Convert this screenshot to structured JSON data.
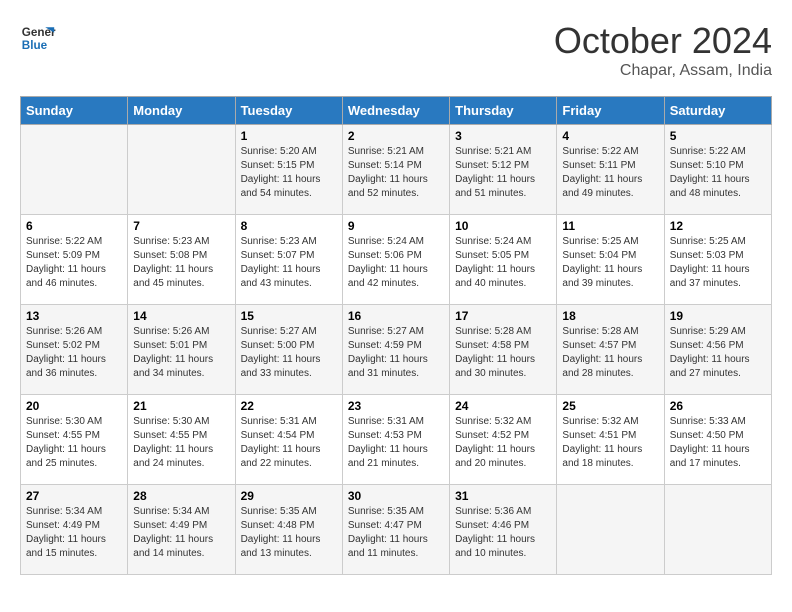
{
  "header": {
    "logo_line1": "General",
    "logo_line2": "Blue",
    "month": "October 2024",
    "location": "Chapar, Assam, India"
  },
  "weekdays": [
    "Sunday",
    "Monday",
    "Tuesday",
    "Wednesday",
    "Thursday",
    "Friday",
    "Saturday"
  ],
  "weeks": [
    [
      {
        "day": "",
        "info": ""
      },
      {
        "day": "",
        "info": ""
      },
      {
        "day": "1",
        "info": "Sunrise: 5:20 AM\nSunset: 5:15 PM\nDaylight: 11 hours and 54 minutes."
      },
      {
        "day": "2",
        "info": "Sunrise: 5:21 AM\nSunset: 5:14 PM\nDaylight: 11 hours and 52 minutes."
      },
      {
        "day": "3",
        "info": "Sunrise: 5:21 AM\nSunset: 5:12 PM\nDaylight: 11 hours and 51 minutes."
      },
      {
        "day": "4",
        "info": "Sunrise: 5:22 AM\nSunset: 5:11 PM\nDaylight: 11 hours and 49 minutes."
      },
      {
        "day": "5",
        "info": "Sunrise: 5:22 AM\nSunset: 5:10 PM\nDaylight: 11 hours and 48 minutes."
      }
    ],
    [
      {
        "day": "6",
        "info": "Sunrise: 5:22 AM\nSunset: 5:09 PM\nDaylight: 11 hours and 46 minutes."
      },
      {
        "day": "7",
        "info": "Sunrise: 5:23 AM\nSunset: 5:08 PM\nDaylight: 11 hours and 45 minutes."
      },
      {
        "day": "8",
        "info": "Sunrise: 5:23 AM\nSunset: 5:07 PM\nDaylight: 11 hours and 43 minutes."
      },
      {
        "day": "9",
        "info": "Sunrise: 5:24 AM\nSunset: 5:06 PM\nDaylight: 11 hours and 42 minutes."
      },
      {
        "day": "10",
        "info": "Sunrise: 5:24 AM\nSunset: 5:05 PM\nDaylight: 11 hours and 40 minutes."
      },
      {
        "day": "11",
        "info": "Sunrise: 5:25 AM\nSunset: 5:04 PM\nDaylight: 11 hours and 39 minutes."
      },
      {
        "day": "12",
        "info": "Sunrise: 5:25 AM\nSunset: 5:03 PM\nDaylight: 11 hours and 37 minutes."
      }
    ],
    [
      {
        "day": "13",
        "info": "Sunrise: 5:26 AM\nSunset: 5:02 PM\nDaylight: 11 hours and 36 minutes."
      },
      {
        "day": "14",
        "info": "Sunrise: 5:26 AM\nSunset: 5:01 PM\nDaylight: 11 hours and 34 minutes."
      },
      {
        "day": "15",
        "info": "Sunrise: 5:27 AM\nSunset: 5:00 PM\nDaylight: 11 hours and 33 minutes."
      },
      {
        "day": "16",
        "info": "Sunrise: 5:27 AM\nSunset: 4:59 PM\nDaylight: 11 hours and 31 minutes."
      },
      {
        "day": "17",
        "info": "Sunrise: 5:28 AM\nSunset: 4:58 PM\nDaylight: 11 hours and 30 minutes."
      },
      {
        "day": "18",
        "info": "Sunrise: 5:28 AM\nSunset: 4:57 PM\nDaylight: 11 hours and 28 minutes."
      },
      {
        "day": "19",
        "info": "Sunrise: 5:29 AM\nSunset: 4:56 PM\nDaylight: 11 hours and 27 minutes."
      }
    ],
    [
      {
        "day": "20",
        "info": "Sunrise: 5:30 AM\nSunset: 4:55 PM\nDaylight: 11 hours and 25 minutes."
      },
      {
        "day": "21",
        "info": "Sunrise: 5:30 AM\nSunset: 4:55 PM\nDaylight: 11 hours and 24 minutes."
      },
      {
        "day": "22",
        "info": "Sunrise: 5:31 AM\nSunset: 4:54 PM\nDaylight: 11 hours and 22 minutes."
      },
      {
        "day": "23",
        "info": "Sunrise: 5:31 AM\nSunset: 4:53 PM\nDaylight: 11 hours and 21 minutes."
      },
      {
        "day": "24",
        "info": "Sunrise: 5:32 AM\nSunset: 4:52 PM\nDaylight: 11 hours and 20 minutes."
      },
      {
        "day": "25",
        "info": "Sunrise: 5:32 AM\nSunset: 4:51 PM\nDaylight: 11 hours and 18 minutes."
      },
      {
        "day": "26",
        "info": "Sunrise: 5:33 AM\nSunset: 4:50 PM\nDaylight: 11 hours and 17 minutes."
      }
    ],
    [
      {
        "day": "27",
        "info": "Sunrise: 5:34 AM\nSunset: 4:49 PM\nDaylight: 11 hours and 15 minutes."
      },
      {
        "day": "28",
        "info": "Sunrise: 5:34 AM\nSunset: 4:49 PM\nDaylight: 11 hours and 14 minutes."
      },
      {
        "day": "29",
        "info": "Sunrise: 5:35 AM\nSunset: 4:48 PM\nDaylight: 11 hours and 13 minutes."
      },
      {
        "day": "30",
        "info": "Sunrise: 5:35 AM\nSunset: 4:47 PM\nDaylight: 11 hours and 11 minutes."
      },
      {
        "day": "31",
        "info": "Sunrise: 5:36 AM\nSunset: 4:46 PM\nDaylight: 11 hours and 10 minutes."
      },
      {
        "day": "",
        "info": ""
      },
      {
        "day": "",
        "info": ""
      }
    ]
  ]
}
